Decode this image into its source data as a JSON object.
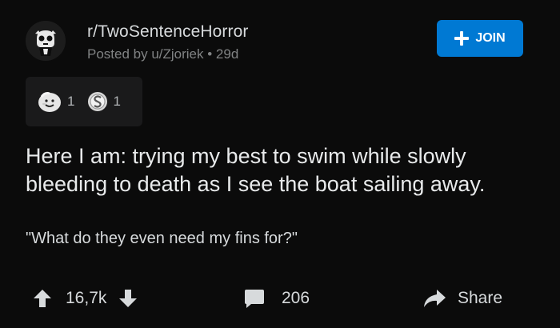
{
  "post": {
    "subreddit": "r/TwoSentenceHorror",
    "posted_by": "Posted by u/Zjoriek • 29d",
    "join_label": "JOIN",
    "awards": [
      {
        "icon": "wholesome-award-icon",
        "count": "1"
      },
      {
        "icon": "silver-award-icon",
        "count": "1"
      }
    ],
    "title": "Here I am: trying my best to swim while slowly bleeding to death as I see the boat sailing away.",
    "body": "\"What do they even need my fins for?\""
  },
  "actions": {
    "votes": "16,7k",
    "comments": "206",
    "share_label": "Share"
  },
  "colors": {
    "background": "#0b0b0b",
    "join_button": "#0079d3",
    "text": "#d7dadc",
    "muted_text": "#818384"
  }
}
